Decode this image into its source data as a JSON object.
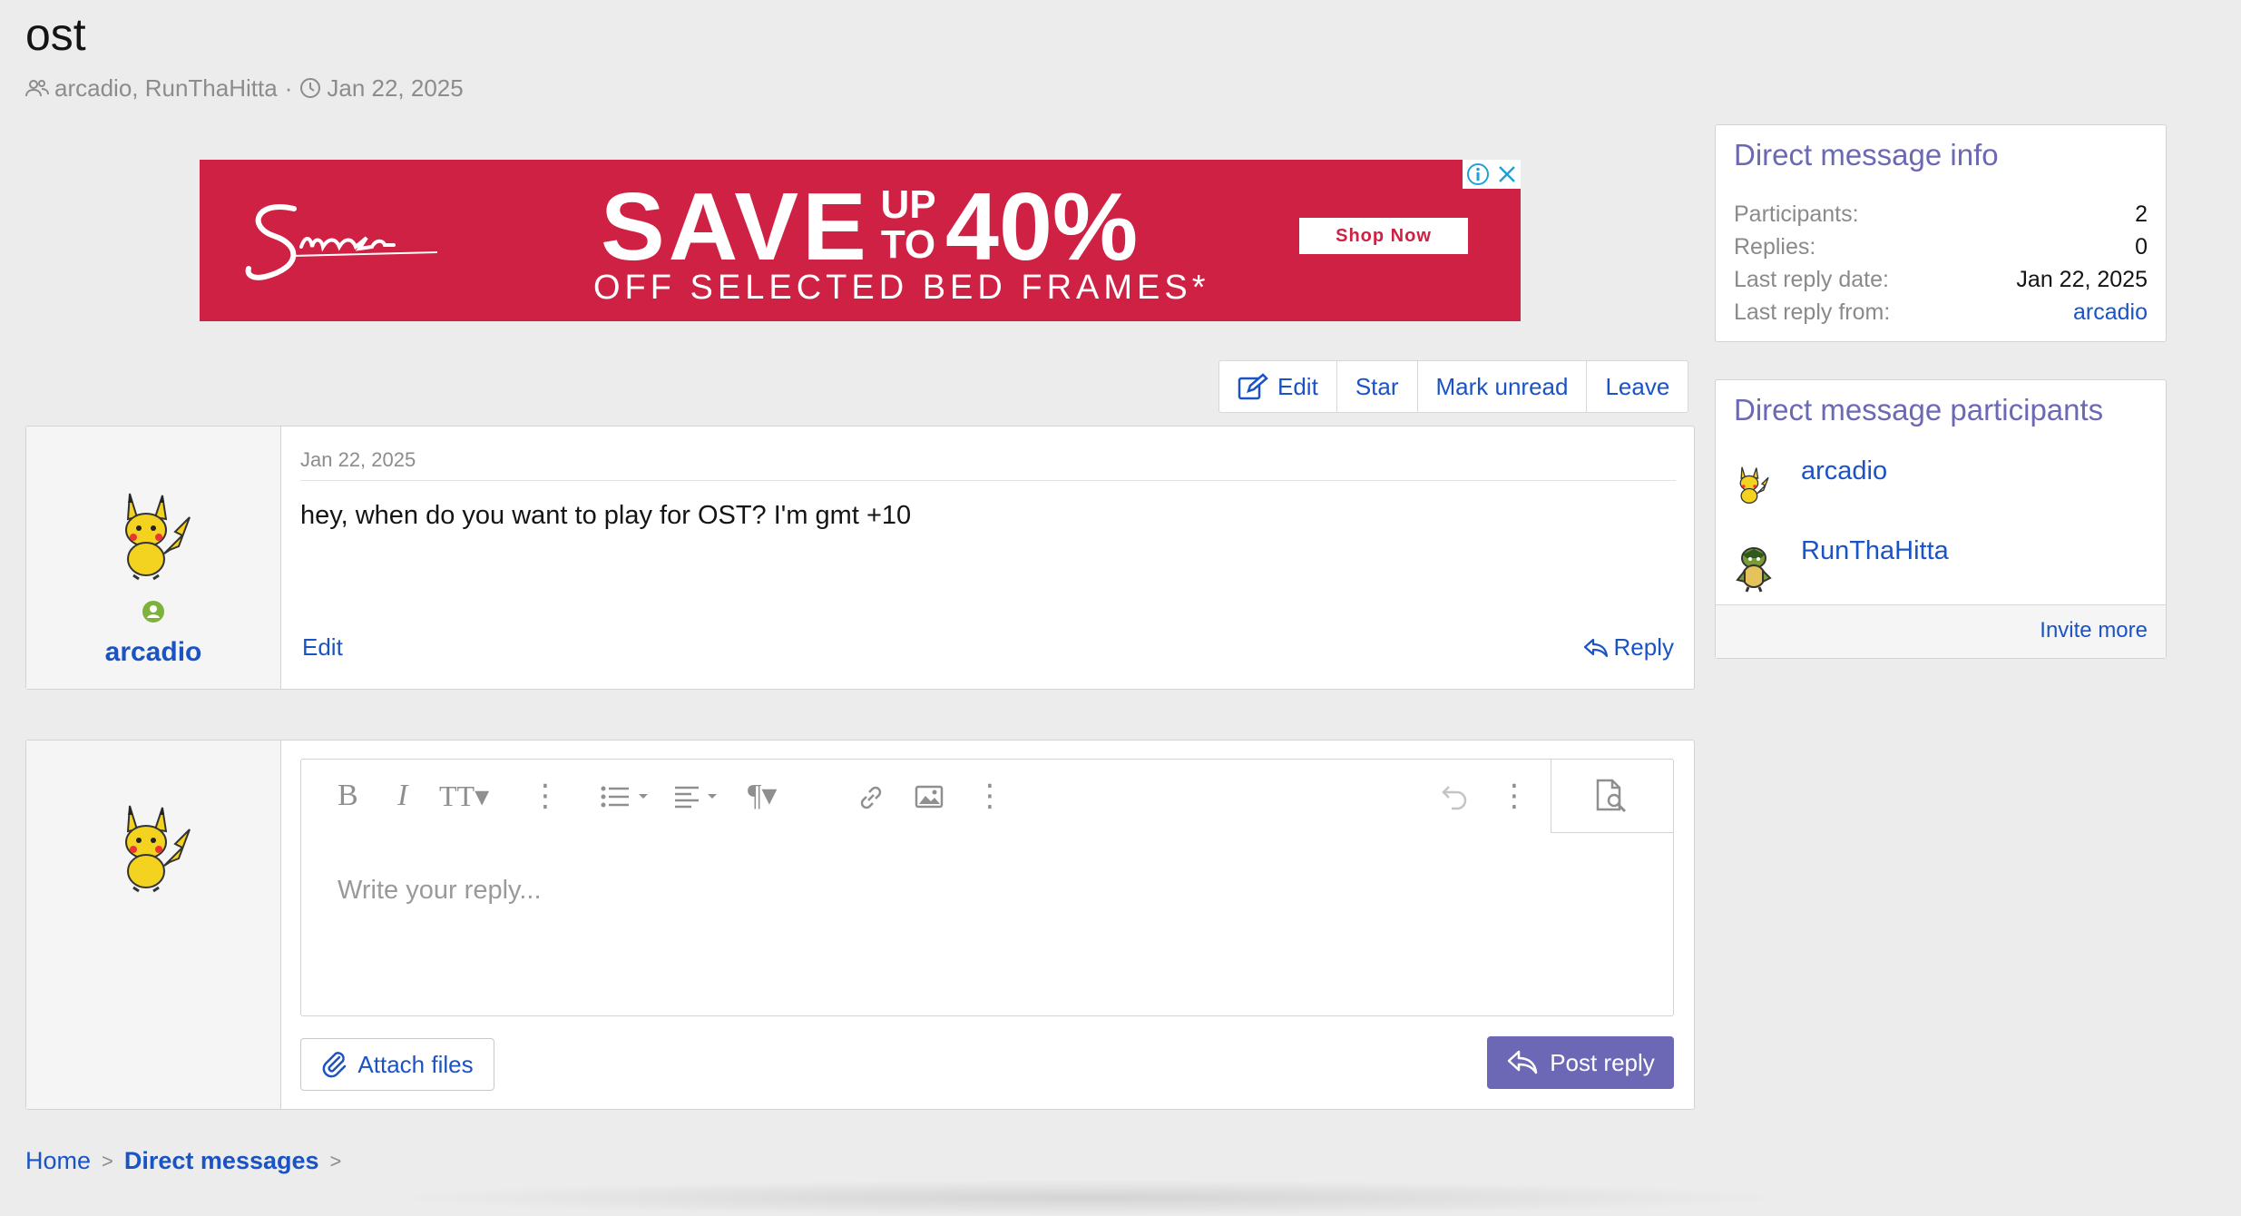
{
  "thread": {
    "title": "ost",
    "participants_text": "arcadio, RunThaHitta",
    "separator": "·",
    "date": "Jan 22, 2025"
  },
  "ad": {
    "brand": "Snooze",
    "headline_save": "SAVE",
    "headline_up": "UP",
    "headline_to": "TO",
    "headline_pct": "40%",
    "subline": "OFF SELECTED BED FRAMES*",
    "cta": "Shop Now",
    "brand_color": "#ce2143"
  },
  "actions": [
    {
      "label": "Edit",
      "icon": "edit-icon"
    },
    {
      "label": "Star"
    },
    {
      "label": "Mark unread"
    },
    {
      "label": "Leave"
    }
  ],
  "message": {
    "author": "arcadio",
    "date": "Jan 22, 2025",
    "body": "hey, when do you want to play for OST? I'm gmt +10",
    "edit_label": "Edit",
    "reply_label": "Reply"
  },
  "editor": {
    "placeholder": "Write your reply...",
    "attach_label": "Attach files",
    "post_label": "Post reply"
  },
  "sidebar": {
    "info": {
      "title": "Direct message info",
      "rows": [
        {
          "label": "Participants:",
          "value": "2"
        },
        {
          "label": "Replies:",
          "value": "0"
        },
        {
          "label": "Last reply date:",
          "value": "Jan 22, 2025"
        },
        {
          "label": "Last reply from:",
          "value": "arcadio"
        }
      ]
    },
    "participants": {
      "title": "Direct message participants",
      "items": [
        {
          "name": "arcadio"
        },
        {
          "name": "RunThaHitta"
        }
      ],
      "invite_label": "Invite more"
    }
  },
  "breadcrumb": {
    "home": "Home",
    "current": "Direct messages"
  },
  "colors": {
    "link": "#1a53c4",
    "sidebar_heading": "#6b68b4",
    "primary_button": "#6d68b6",
    "online": "#7fb23a"
  }
}
